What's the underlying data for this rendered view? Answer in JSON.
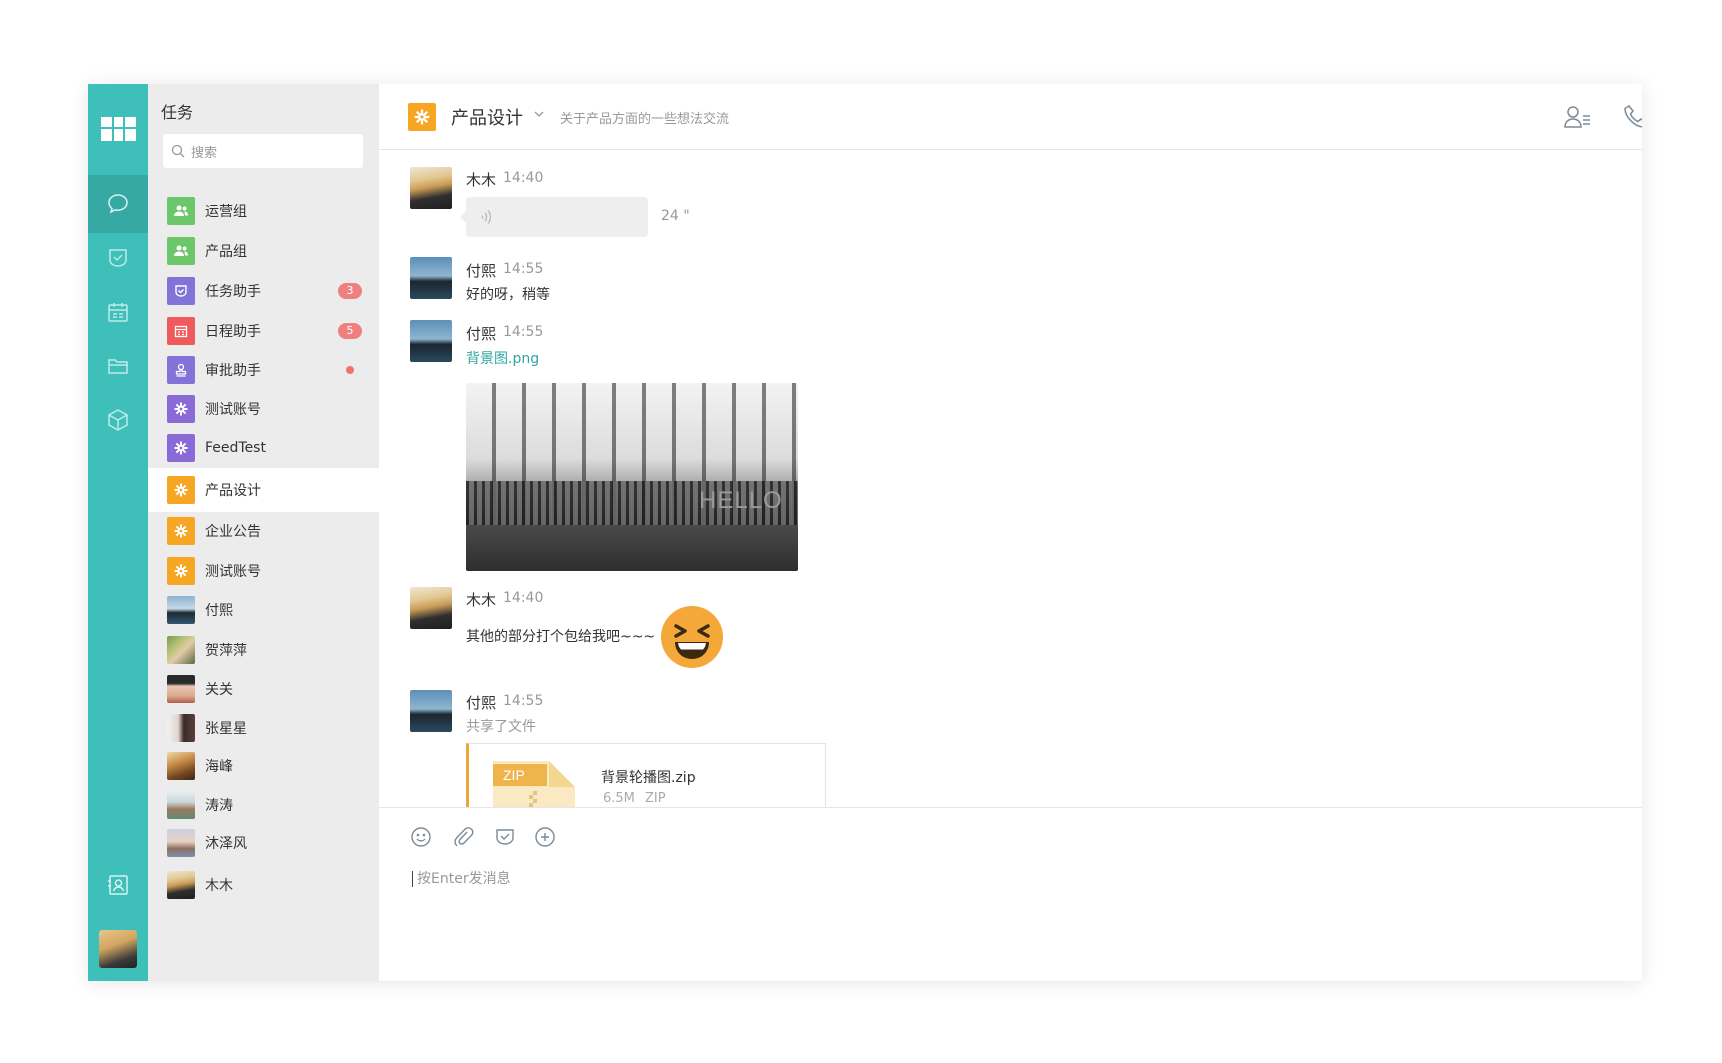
{
  "colors": {
    "rail": "#3fbfb9",
    "accent_orange": "#f6a623",
    "green": "#6cc66a",
    "purple": "#8273d9",
    "red": "#ef5a5a",
    "badge": "#ef8080",
    "link": "#2aa7a0"
  },
  "sidebar": {
    "title": "任务",
    "search_placeholder": "搜索",
    "items": [
      {
        "label": "运营组",
        "icon": "group-icon",
        "color": "#6cc66a"
      },
      {
        "label": "产品组",
        "icon": "group-icon",
        "color": "#6cc66a"
      },
      {
        "label": "任务助手",
        "icon": "task-check-icon",
        "color": "#8273d9",
        "badge": "3"
      },
      {
        "label": "日程助手",
        "icon": "calendar-icon",
        "color": "#ef5a5a",
        "badge": "5"
      },
      {
        "label": "审批助手",
        "icon": "stamp-icon",
        "color": "#8273d9",
        "dot": true
      },
      {
        "label": "测试账号",
        "icon": "gear-icon",
        "color": "#8a6ad6"
      },
      {
        "label": "FeedTest",
        "icon": "gear-icon",
        "color": "#8a6ad6"
      },
      {
        "label": "产品设计",
        "icon": "gear-icon",
        "color": "#f6a623",
        "active": true
      },
      {
        "label": "企业公告",
        "icon": "gear-icon",
        "color": "#f6a623"
      },
      {
        "label": "测试账号",
        "icon": "gear-icon",
        "color": "#f6a623"
      },
      {
        "label": "付熙",
        "icon": "avatar"
      },
      {
        "label": "贺萍萍",
        "icon": "avatar"
      },
      {
        "label": "关关",
        "icon": "avatar"
      },
      {
        "label": "张星星",
        "icon": "avatar"
      },
      {
        "label": "海峰",
        "icon": "avatar"
      },
      {
        "label": "涛涛",
        "icon": "avatar"
      },
      {
        "label": "沐泽风",
        "icon": "avatar"
      },
      {
        "label": "木木",
        "icon": "avatar"
      }
    ]
  },
  "header": {
    "group_name": "产品设计",
    "description": "关于产品方面的一些想法交流"
  },
  "messages": [
    {
      "sender": "木木",
      "time": "14:40",
      "type": "voice",
      "duration": "24 \""
    },
    {
      "sender": "付熙",
      "time": "14:55",
      "type": "text",
      "text": "好的呀，稍等"
    },
    {
      "sender": "付熙",
      "time": "14:55",
      "type": "image",
      "filename": "背景图.png",
      "image_text": "HELLO"
    },
    {
      "sender": "木木",
      "time": "14:40",
      "type": "text_emoji",
      "text": "其他的部分打个包给我吧~~~"
    },
    {
      "sender": "付熙",
      "time": "14:55",
      "type": "file",
      "subtitle": "共享了文件",
      "file": {
        "name": "背景轮播图.zip",
        "size": "6.5M",
        "type": "ZIP",
        "icon_label": "ZIP"
      }
    }
  ],
  "composer": {
    "placeholder": "按Enter发消息"
  }
}
